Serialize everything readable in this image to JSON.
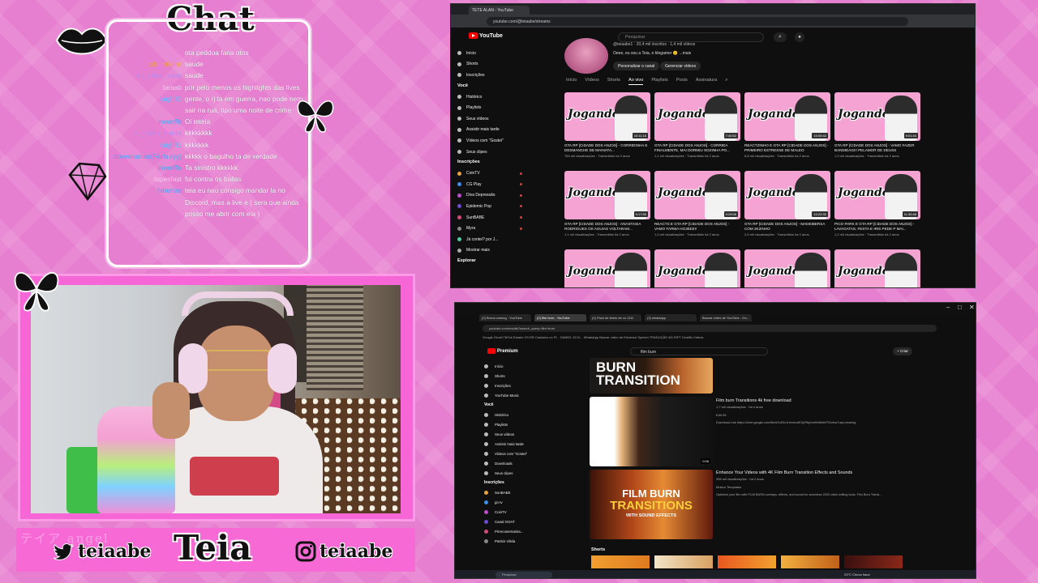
{
  "overlay": {
    "chat_title": "Chat",
    "messages": [
      {
        "user": "",
        "text": "ota peddoa faria otos",
        "color": "#ffffff"
      },
      {
        "user": "cdnimhand",
        "text": "saude",
        "color": "#f0a040"
      },
      {
        "user": "ra_rafaa_aaaa",
        "text": "saude",
        "color": "#b88cf0"
      },
      {
        "user": "taraati",
        "text": "por pelo menos os highlights das lives",
        "color": "#f7c8ee"
      },
      {
        "user": "luigh01",
        "text": "gente, o rj ta em guerra, nao pode nem sair na rua, tipo uma noite de crime",
        "color": "#66b8ff"
      },
      {
        "user": "inwerffe",
        "text": "Oi tetela",
        "color": "#4ea4f5"
      },
      {
        "user": "mi_sanu_marra",
        "text": "kkkkkkkk",
        "color": "#b88cf0"
      },
      {
        "user": "luigh01",
        "text": "kkkkkkk",
        "color": "#66b8ff"
      },
      {
        "user": "tioveenanae(Forla.ryy)",
        "text": "kkkkk o bagulho ta de verdade",
        "color": "#4ea4f5"
      },
      {
        "user": "inwerffe",
        "text": "Ta sinistro kkkkkk",
        "color": "#4ea4f5"
      },
      {
        "user": "tapesfast",
        "text": "foi contra os ballas",
        "color": "#f7c8ee"
      },
      {
        "user": "hibertas",
        "text": "teia eu nao consigo mandar la no Discord, mas a live e ( sera que ainda posso me abrir com ela )",
        "color": "#4ea4f5"
      }
    ],
    "social_left": "teiaabe",
    "logo": "Teia",
    "social_right": "teiaabe",
    "banner_faint": "テイア angel"
  },
  "yt_top": {
    "tab_title": "TETE ALAN - YouTube",
    "url": "youtube.com/@teiaabe/streams",
    "brand": "YouTube",
    "search_placeholder": "Pesquisar",
    "sidebar_main": [
      "Início",
      "Shorts",
      "Inscrições"
    ],
    "you_label": "Você",
    "sidebar_you": [
      "Histórico",
      "Playlists",
      "Seus vídeos",
      "Assistir mais tarde",
      "Vídeos com \"Gostei\"",
      "Seus clipes"
    ],
    "subs_label": "Inscrições",
    "sidebar_subs": [
      "CoinTV",
      "CG Play",
      "Diva Depressão",
      "Epidemic Pop",
      "SunBABE",
      "Myra",
      "Já contei? por J...",
      "Mostrar mais"
    ],
    "explore_label": "Explorar",
    "channel_line1": "@teiaabe1 · 20,4 mil inscritos · 1,4 mil vídeos",
    "channel_line2": "Oeee, eu sou a Teia, e blogamer 😊 ...mais",
    "btn_customize": "Personalizar o canal",
    "btn_manage": "Gerenciar vídeos",
    "channel_tabs": [
      "Início",
      "Vídeos",
      "Shorts",
      "Ao vivo",
      "Playlists",
      "Posts",
      "Assinatura"
    ],
    "active_tab": "Ao vivo",
    "thumb_text": "Jogando",
    "videos": [
      {
        "title": "GTA RP [CIDADE DOS ANJOS] - CORRIDINHA E DESMANCHE DE MAINATA...",
        "meta": "784 mil visualizações · Transmitido há 2 anos",
        "dur": "10:11:16"
      },
      {
        "title": "GTA RP [CIDADE DOS ANJOS] - CORRIDA FINALMENTE, MAI DORMIU SOZINHA PO...",
        "meta": "1,1 mil visualizações · Transmitido há 2 anos",
        "dur": "7:40:52"
      },
      {
        "title": "REACTZINHO E GTA RP [CIDADE DOS ANJOS] - PRIMEIRO ESTRESSE DE MALEO",
        "meta": "8,8 mil visualizações · Transmitido há 2 anos",
        "dur": "10:05:42"
      },
      {
        "title": "GTA RP [CIDADE DOS ANJOS] - VAMO FAZER BANDIDAGI!! PELAMOR DE DEUSS",
        "meta": "1,3 mil visualizações · Transmitido há 2 anos",
        "dur": "9:01:44"
      },
      {
        "title": "GTA RP [CIDADE DOS ANJOS] - ANASTASIA RODRIGUES OS AGUIAS VOLTARAM...",
        "meta": "1,1 mil visualizações · Transmitido há 2 anos",
        "dur": "9:17:50"
      },
      {
        "title": "REACTS E GTA RP [CIDADE DOS ANJOS] - VAMO FARMA HOJEEE!!",
        "meta": "1,4 mil visualizações · Transmitido há 2 anos",
        "dur": "9:29:06"
      },
      {
        "title": "GTA RP [CIDADE DOS ANJOS] - MADEIBERSA COM 2K2INHO",
        "meta": "2,5 mil visualizações · Transmitido há 2 anos",
        "dur": "10:22:32"
      },
      {
        "title": "PICO PARK E GTA RP [CIDADE DOS ANJOS] - LAVAGATAS, FESTA E IRIS PEDE P MAI...",
        "meta": "1,2 mil visualizações · Transmitido há 2 anos",
        "dur": "11:30:46"
      },
      {
        "title": "",
        "meta": "",
        "dur": ""
      },
      {
        "title": "",
        "meta": "",
        "dur": ""
      },
      {
        "title": "",
        "meta": "",
        "dur": ""
      },
      {
        "title": "",
        "meta": "",
        "dur": ""
      }
    ]
  },
  "yt_bottom": {
    "tabs": [
      "(2) Bruna coming - YouTube",
      "(2) film burn - YouTube",
      "(2) Pack de teleio de vo 1111",
      "(3) whatsapp",
      "Buscar vídeo de YouTube - Go..."
    ],
    "url": "youtube.com/results?search_query=film+burn",
    "bookmarks": "Google  Gmail  TikTok  Estado VS DR  Cadastro no Pl...  DANIEL 33 Vi...  WhatsApp  Buscar vídeo de  Enhance Speech  TRADUÇÃO AD  RIFT  Cineflix  Vídeos",
    "brand": "Premium",
    "search_query": "film burn",
    "create": "+ Criar",
    "sidebar_main": [
      "Início",
      "Shorts",
      "Inscrições",
      "YouTube Music"
    ],
    "you_label": "Você",
    "sidebar_you": [
      "Histórico",
      "Playlists",
      "Seus vídeos",
      "Assistir mais tarde",
      "Vídeos com \"Gostei\"",
      "Downloads",
      "Seus clipes"
    ],
    "subs_label": "Inscrições",
    "sidebar_subs": [
      "SunBABE",
      "gn tv",
      "CoinTV",
      "Canal GOAT",
      "Pirrecosemaima...",
      "Patrick Vilela"
    ],
    "thumb0_text": "BURN TRANSITION",
    "result1_title": "Film burn Transitions 4k free download",
    "result1_meta": "1,7 mil visualizações · há 4 anos",
    "result1_desc": "Download Link https://drive.google.com/file/d/1vfDo1rbmmxdE3yFfbjlvmlHbWeIhPD/view?usp=sharing",
    "result1_channel": "Edit 99",
    "result1_dur": "0:06",
    "result2_title": "Enhance Your Videos with 4K Film Burn Transition Effects and Sounds",
    "result2_meta": "396 mil visualizações · há 2 anos",
    "result2_channel": "Motion Templates",
    "result2_desc": "Optimize your film with FILM BURN overlays, effects, and sound for seamless 2023 video editing tools. Film Burn Transi...",
    "thumb2_line1": "FILM BURN",
    "thumb2_line2": "TRANSITIONS",
    "thumb2_line3": "WITH SOUND EFFECTS",
    "shorts_label": "Shorts",
    "taskbar_search": "Pesquisar",
    "weather": "23°C  Chuva fraca"
  },
  "colors": {
    "bg_pink": "#e77fd0",
    "frame_pink": "#f766d6",
    "yt_red": "#ff0000",
    "yt_dark": "#0f0f0f"
  }
}
